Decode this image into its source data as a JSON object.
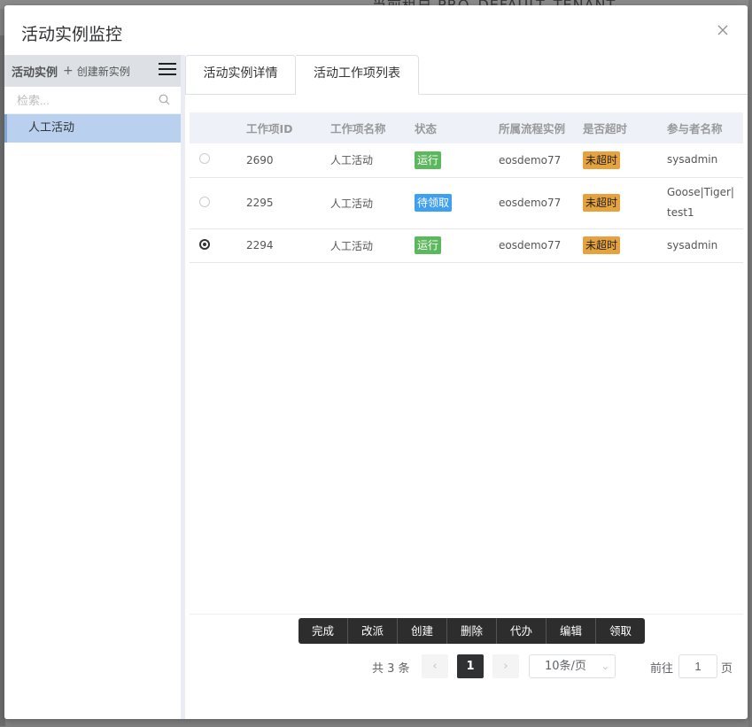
{
  "backdrop": {
    "text": "当前租户 PRO_DEFAULT_TENANT"
  },
  "dialog": {
    "title": "活动实例监控"
  },
  "sidebar": {
    "title": "活动实例",
    "plus": "+",
    "create_label": "创建新实例",
    "search_placeholder": "检索...",
    "items": [
      {
        "label": "人工活动"
      }
    ]
  },
  "tabs": [
    {
      "label": "活动实例详情"
    },
    {
      "label": "活动工作项列表",
      "active": true
    }
  ],
  "table": {
    "headers": [
      "工作项ID",
      "工作项名称",
      "状态",
      "所属流程实例",
      "是否超时",
      "参与者名称"
    ],
    "rows": [
      {
        "id": "2690",
        "name": "人工活动",
        "status": "运行",
        "status_color": "#5cb85c",
        "process": "eosdemo77",
        "timeout": "未超时",
        "participants": "sysadmin",
        "selected": false
      },
      {
        "id": "2295",
        "name": "人工活动",
        "status": "待领取",
        "status_color": "#3f9ff0",
        "process": "eosdemo77",
        "timeout": "未超时",
        "participants": "Goose|Tiger|test1",
        "selected": false
      },
      {
        "id": "2294",
        "name": "人工活动",
        "status": "运行",
        "status_color": "#5cb85c",
        "process": "eosdemo77",
        "timeout": "未超时",
        "participants": "sysadmin",
        "selected": true
      }
    ]
  },
  "toolbar": {
    "buttons": [
      "完成",
      "改派",
      "创建",
      "删除",
      "代办",
      "编辑",
      "领取"
    ]
  },
  "pagination": {
    "total_text": "共 3 条",
    "current_page": "1",
    "page_size": "10条/页",
    "goto_label": "前往",
    "goto_value": "1",
    "goto_unit": "页"
  },
  "icons": {
    "close": "close-icon",
    "menu": "hamburger-menu-icon",
    "search": "search-icon",
    "prev": "chevron-left-icon",
    "next": "chevron-right-icon",
    "dropdown": "chevron-down-icon"
  }
}
